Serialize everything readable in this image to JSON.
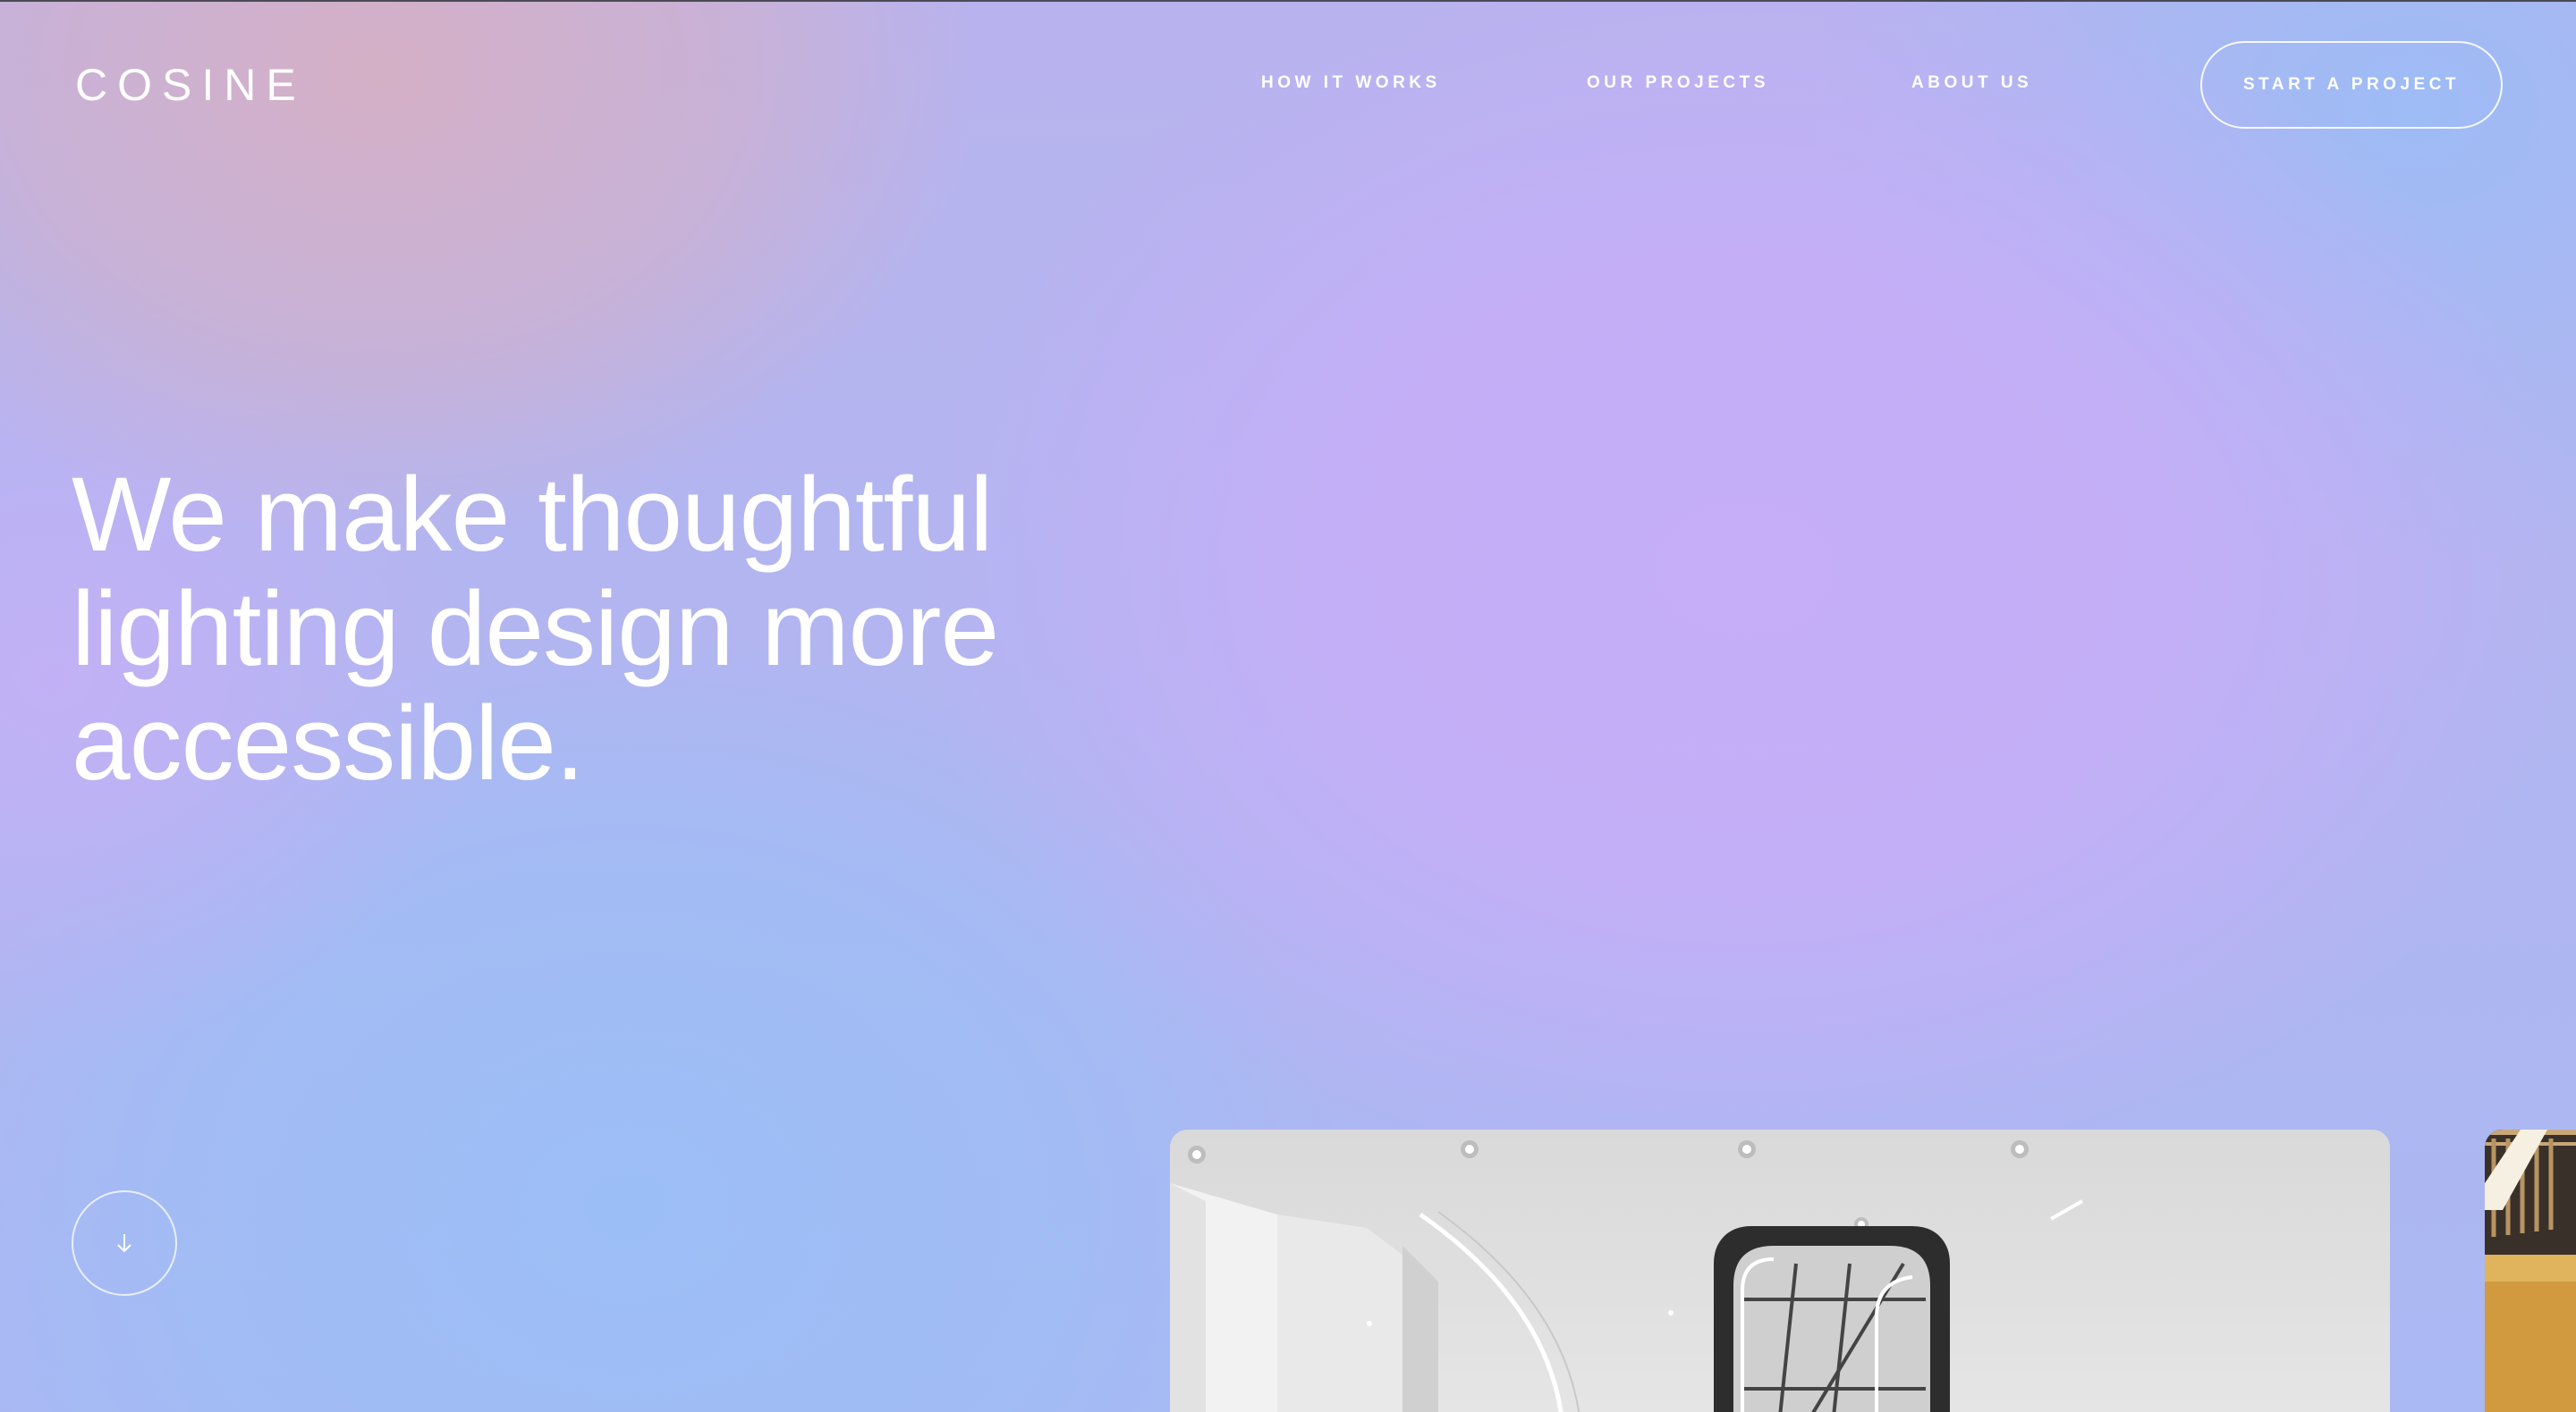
{
  "header": {
    "logo": "COSINE",
    "nav": [
      {
        "label": "HOW IT WORKS"
      },
      {
        "label": "OUR PROJECTS"
      },
      {
        "label": "ABOUT US"
      }
    ],
    "cta_label": "START A PROJECT"
  },
  "hero": {
    "lines": [
      "We make thoughtful",
      "lighting design more",
      "accessible."
    ]
  },
  "icons": {
    "scroll": "arrow-down-icon"
  },
  "colors": {
    "text": "#ffffff",
    "gradient_pink": "#d6b0c4",
    "gradient_lilac": "#c6aef8",
    "gradient_blue": "#9cbef6"
  }
}
